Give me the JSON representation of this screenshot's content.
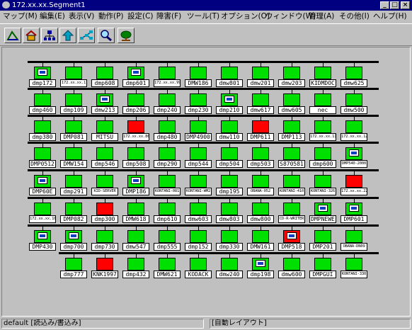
{
  "window": {
    "title": "172.xx.xx.Segment1"
  },
  "menu": [
    "マップ(M)",
    "編集(E)",
    "表示(V)",
    "動作(P)",
    "設定(C)",
    "障害(F)",
    "ツール(T)",
    "オプション(O)",
    "ウィンドウ(W)",
    "管理(A)",
    "その他(I)",
    "ヘルプ(H)"
  ],
  "toolbar": [
    "segment-icon",
    "home-icon",
    "network-icon",
    "up-arrow-icon",
    "topology-icon",
    "search-icon",
    "tree-icon"
  ],
  "colors": {
    "normal": "#00e000",
    "alarm": "#ff0000",
    "bus": "#000000"
  },
  "rows": [
    [
      {
        "label": "dmp172",
        "type": "pc"
      },
      {
        "label": "172.xx.xx.1",
        "type": "green"
      },
      {
        "label": "dmp608",
        "type": "green"
      },
      {
        "label": "dmp601",
        "type": "pc"
      },
      {
        "label": "172.xx.xx.99",
        "type": "green"
      },
      {
        "label": "DMW186",
        "type": "green"
      },
      {
        "label": "dmw801",
        "type": "green"
      },
      {
        "label": "dmw201",
        "type": "green"
      },
      {
        "label": "dmw203",
        "type": "green"
      },
      {
        "label": "KIDMDOC",
        "type": "green"
      },
      {
        "label": "dmw625",
        "type": "green"
      }
    ],
    [
      {
        "label": "dmp460",
        "type": "green"
      },
      {
        "label": "dmp109",
        "type": "green"
      },
      {
        "label": "dmw213",
        "type": "pc"
      },
      {
        "label": "dmp206",
        "type": "green"
      },
      {
        "label": "dmp240",
        "type": "green"
      },
      {
        "label": "dmp230",
        "type": "green"
      },
      {
        "label": "dmp210",
        "type": "pc"
      },
      {
        "label": "dmw617",
        "type": "green"
      },
      {
        "label": "dmw605",
        "type": "green"
      },
      {
        "label": "nec",
        "type": "green"
      },
      {
        "label": "dmw500",
        "type": "green"
      }
    ],
    [
      {
        "label": "dmp380",
        "type": "green"
      },
      {
        "label": "DMP081",
        "type": "green"
      },
      {
        "label": "MITSU",
        "type": "green"
      },
      {
        "label": "172.xx.xx.86",
        "type": "red"
      },
      {
        "label": "dmp480",
        "type": "green"
      },
      {
        "label": "DMP4900",
        "type": "green"
      },
      {
        "label": "dmw110",
        "type": "green"
      },
      {
        "label": "DMP611",
        "type": "red"
      },
      {
        "label": "DMP113",
        "type": "green"
      },
      {
        "label": "172.xx.xx.11",
        "type": "green"
      },
      {
        "label": "172.xx.xx.128",
        "type": "green"
      }
    ],
    [
      {
        "label": "DMP0512",
        "type": "green"
      },
      {
        "label": "DMW154",
        "type": "green"
      },
      {
        "label": "dmp546",
        "type": "green"
      },
      {
        "label": "dmp508",
        "type": "green"
      },
      {
        "label": "dmp290",
        "type": "green"
      },
      {
        "label": "dmp544",
        "type": "green"
      },
      {
        "label": "dmp504",
        "type": "green"
      },
      {
        "label": "dmp503",
        "type": "green"
      },
      {
        "label": "S870581",
        "type": "green"
      },
      {
        "label": "dmp600",
        "type": "green"
      },
      {
        "label": "DMP540-2000",
        "type": "pc"
      }
    ],
    [
      {
        "label": "DMP60E",
        "type": "pc"
      },
      {
        "label": "dmp291",
        "type": "green"
      },
      {
        "label": "KID-SERVER",
        "type": "green"
      },
      {
        "label": "DMP186",
        "type": "pc"
      },
      {
        "label": "KONTANI-081",
        "type": "green"
      },
      {
        "label": "KONTANI-WM2",
        "type": "green"
      },
      {
        "label": "dmp195",
        "type": "green"
      },
      {
        "label": "OBANA-052",
        "type": "green"
      },
      {
        "label": "KONTANI-410",
        "type": "green"
      },
      {
        "label": "KONTANI-326",
        "type": "green"
      },
      {
        "label": "172.xx.xx.227",
        "type": "red"
      }
    ],
    [
      {
        "label": "172.xx.xx.107",
        "type": "green"
      },
      {
        "label": "DMP082",
        "type": "green"
      },
      {
        "label": "dmp300",
        "type": "red"
      },
      {
        "label": "DMW618",
        "type": "green"
      },
      {
        "label": "dmp610",
        "type": "green"
      },
      {
        "label": "dmw603",
        "type": "green"
      },
      {
        "label": "dmw803",
        "type": "green"
      },
      {
        "label": "dmw800",
        "type": "green"
      },
      {
        "label": "CD-R-WRITER",
        "type": "green"
      },
      {
        "label": "DMPNEWE",
        "type": "pc"
      },
      {
        "label": "DMP601",
        "type": "pc"
      }
    ],
    [
      {
        "label": "DMP430",
        "type": "pc"
      },
      {
        "label": "dmp700",
        "type": "pc"
      },
      {
        "label": "dmp730",
        "type": "green"
      },
      {
        "label": "dmw547",
        "type": "green"
      },
      {
        "label": "dmp555",
        "type": "green"
      },
      {
        "label": "dmp152",
        "type": "green"
      },
      {
        "label": "dmp330",
        "type": "green"
      },
      {
        "label": "DMW161",
        "type": "green"
      },
      {
        "label": "DMP518",
        "type": "pcred"
      },
      {
        "label": "DMP201",
        "type": "green"
      },
      {
        "label": "OBANA-DN09",
        "type": "green"
      }
    ],
    [
      {
        "label": "dmp777",
        "type": "green"
      },
      {
        "label": "KNK1997",
        "type": "red"
      },
      {
        "label": "dmp432",
        "type": "green"
      },
      {
        "label": "DMW621",
        "type": "green"
      },
      {
        "label": "KODACK",
        "type": "green"
      },
      {
        "label": "dmw240",
        "type": "green"
      },
      {
        "label": "dmp198",
        "type": "pc"
      },
      {
        "label": "dmw600",
        "type": "green"
      },
      {
        "label": "DMPGUI",
        "type": "green"
      },
      {
        "label": "KONTANI-330",
        "type": "green"
      }
    ]
  ],
  "status": {
    "left": "default [読込み/書込み]",
    "right": "[自動レイアウト]"
  }
}
